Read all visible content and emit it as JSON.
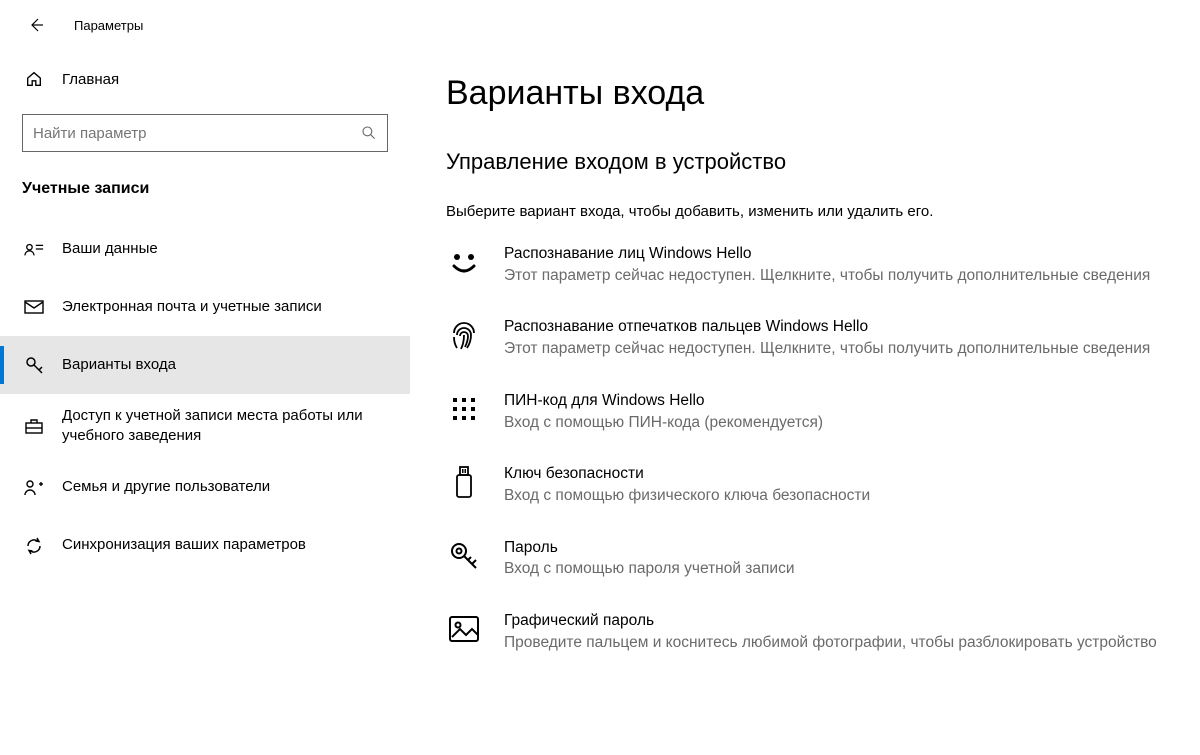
{
  "window": {
    "title": "Параметры"
  },
  "sidebar": {
    "home": "Главная",
    "search_placeholder": "Найти параметр",
    "section": "Учетные записи",
    "items": [
      {
        "label": "Ваши данные"
      },
      {
        "label": "Электронная почта и учетные записи"
      },
      {
        "label": "Варианты входа"
      },
      {
        "label": "Доступ к учетной записи места работы или учебного заведения"
      },
      {
        "label": "Семья и другие пользователи"
      },
      {
        "label": "Синхронизация ваших параметров"
      }
    ]
  },
  "main": {
    "title": "Варианты входа",
    "subheading": "Управление входом в устройство",
    "instruction": "Выберите вариант входа, чтобы добавить, изменить или удалить его.",
    "options": [
      {
        "title": "Распознавание лиц Windows Hello",
        "desc": "Этот параметр сейчас недоступен. Щелкните, чтобы получить дополнительные сведения"
      },
      {
        "title": "Распознавание отпечатков пальцев Windows Hello",
        "desc": "Этот параметр сейчас недоступен. Щелкните, чтобы получить дополнительные сведения"
      },
      {
        "title": "ПИН-код для Windows Hello",
        "desc": "Вход с помощью ПИН-кода (рекомендуется)"
      },
      {
        "title": "Ключ безопасности",
        "desc": "Вход с помощью физического ключа безопасности"
      },
      {
        "title": "Пароль",
        "desc": "Вход с помощью пароля учетной записи"
      },
      {
        "title": "Графический пароль",
        "desc": "Проведите пальцем и коснитесь любимой фотографии, чтобы разблокировать устройство"
      }
    ]
  }
}
